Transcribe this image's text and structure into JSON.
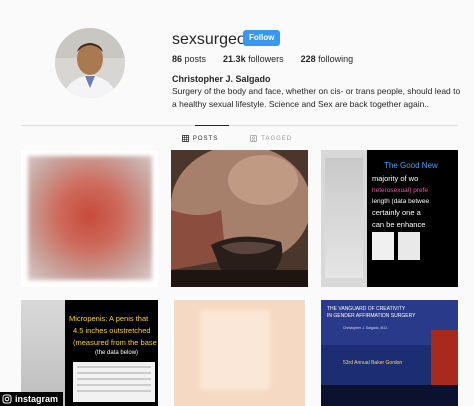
{
  "profile": {
    "username": "sexsurgeon",
    "follow_label": "Follow",
    "posts_count": "86",
    "posts_label": "posts",
    "followers_count": "21.3k",
    "followers_label": "followers",
    "following_count": "228",
    "following_label": "following",
    "full_name": "Christopher J. Salgado",
    "bio": "Surgery of the body and face, whether on cis- or trans people, should lead to a healthy sexual lifestyle. Science and Sex are back together again.."
  },
  "tabs": [
    {
      "label": "POSTS",
      "icon": "grid-icon",
      "active": true
    },
    {
      "label": "TAGGED",
      "icon": "tag-icon",
      "active": false
    }
  ],
  "posts": [
    {
      "name": "post-1-blurred",
      "lines": []
    },
    {
      "name": "post-2-photo",
      "lines": []
    },
    {
      "name": "post-3-slide",
      "lines": [
        "The Good New",
        "majority of wo",
        "heterosexual) prefe",
        "length (data betwee",
        "certainly one a",
        "can be enhance"
      ]
    },
    {
      "name": "post-4-slide",
      "lines": [
        "Micropenis: A penis that",
        "4.5 inches outstretched",
        "(measured from the base o",
        "(the data below)"
      ]
    },
    {
      "name": "post-5-blurred",
      "lines": []
    },
    {
      "name": "post-6-conference",
      "lines": [
        "THE VANGUARD OF CREATIVITY",
        "IN GENDER AFFIRMATION SURGERY",
        "Christopher J. Salgado, M.D.",
        "53rd Annual Baker Gordon"
      ]
    }
  ],
  "watermark": {
    "icon": "instagram-icon",
    "label": "instagram"
  },
  "colors": {
    "accent": "#3897f0",
    "text": "#262626",
    "muted": "#8e8e8e",
    "background": "#fafafa"
  }
}
